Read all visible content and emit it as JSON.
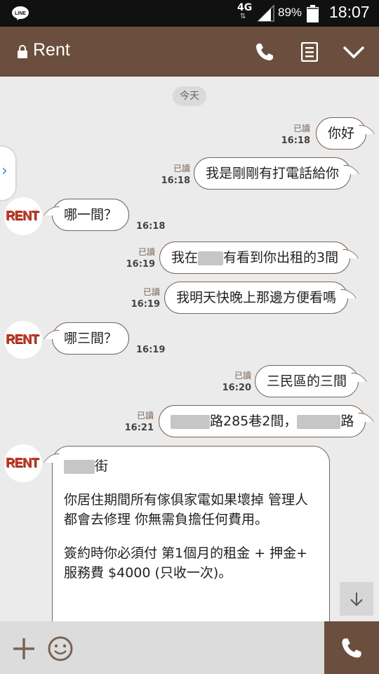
{
  "status_bar": {
    "network": "4G",
    "battery": "89%",
    "time": "18:07",
    "app_icon": "LINE"
  },
  "header": {
    "title": "Rent",
    "icons": [
      "lock-icon",
      "phone-icon",
      "notes-icon",
      "chevron-down-icon"
    ]
  },
  "chat": {
    "date_label": "今天",
    "messages": [
      {
        "side": "right",
        "text": "你好",
        "read": "已讀",
        "time": "16:18"
      },
      {
        "side": "right",
        "text": "我是剛剛有打電話給你",
        "read": "已讀",
        "time": "16:18"
      },
      {
        "side": "left",
        "text": "哪一間？",
        "time": "16:18",
        "sender": "RENT"
      },
      {
        "side": "right",
        "text_before": "我在",
        "text_after": "有看到你出租的3間",
        "read": "已讀",
        "time": "16:19"
      },
      {
        "side": "right",
        "text": "我明天快晚上那邊方便看嗎",
        "read": "已讀",
        "time": "16:19"
      },
      {
        "side": "left",
        "text": "哪三間？",
        "time": "16:19",
        "sender": "RENT"
      },
      {
        "side": "right",
        "text": "三民區的三間",
        "read": "已讀",
        "time": "16:20"
      },
      {
        "side": "right",
        "text_mid": "路285巷2間，",
        "text_end": "路",
        "read": "已讀",
        "time": "16:21"
      },
      {
        "side": "left",
        "sender": "RENT",
        "line1_suffix": "街",
        "para1": "你居住期間所有傢俱家電如果壞掉 管理人都會去修理 你無需負擔任何費用。",
        "para2": "簽約時你必須付 第1個月的租金 + 押金+ 服務費 $4000 (只收一次)。"
      }
    ]
  },
  "input_bar": {
    "icons": [
      "plus-icon",
      "emoji-icon",
      "call-icon"
    ]
  }
}
